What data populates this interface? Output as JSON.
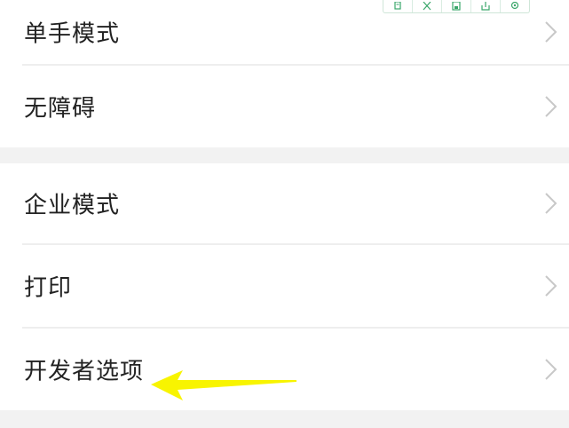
{
  "settings": {
    "items": [
      {
        "label": "单手模式"
      },
      {
        "label": "无障碍"
      },
      {
        "label": "企业模式"
      },
      {
        "label": "打印"
      },
      {
        "label": "开发者选项"
      }
    ]
  },
  "toolbar": {
    "icons": [
      "copy-icon",
      "crop-icon",
      "save-icon",
      "share-icon",
      "settings-icon"
    ],
    "color": "#3aa66a"
  },
  "annotation": {
    "arrow_color": "#f8f400"
  }
}
